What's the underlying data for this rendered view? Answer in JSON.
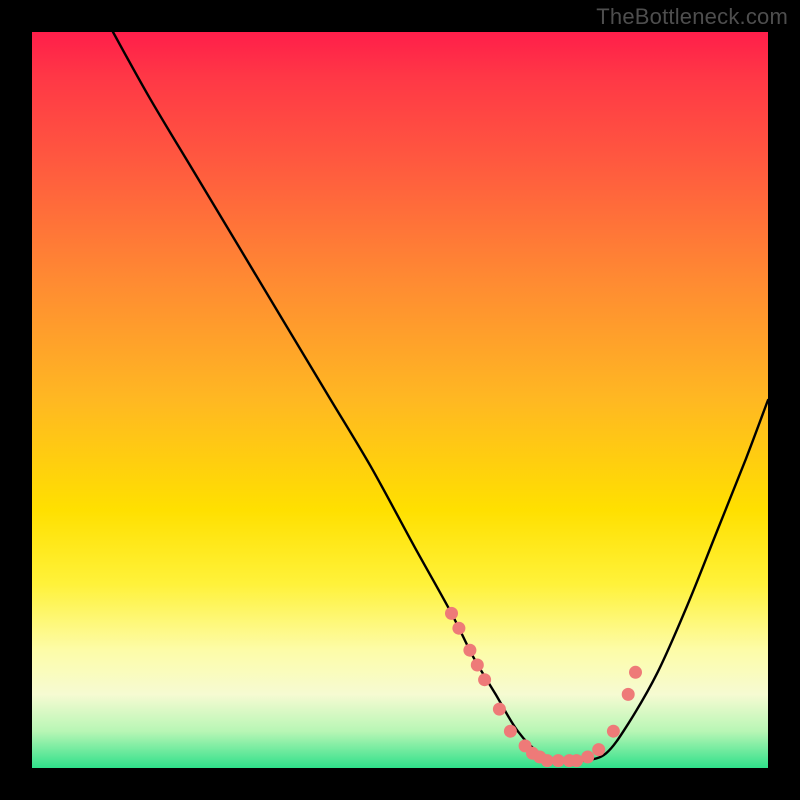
{
  "watermark": "TheBottleneck.com",
  "chart_data": {
    "type": "line",
    "title": "",
    "xlabel": "",
    "ylabel": "",
    "xlim": [
      0,
      100
    ],
    "ylim": [
      0,
      100
    ],
    "series": [
      {
        "name": "bottleneck-curve",
        "x": [
          11,
          16,
          22,
          28,
          34,
          40,
          46,
          52,
          57,
          60,
          63,
          66,
          69,
          72,
          75,
          78,
          81,
          85,
          89,
          93,
          97,
          100
        ],
        "values": [
          100,
          91,
          81,
          71,
          61,
          51,
          41,
          30,
          21,
          15,
          10,
          5,
          2,
          1,
          1,
          2,
          6,
          13,
          22,
          32,
          42,
          50
        ]
      }
    ],
    "markers": {
      "name": "highlight-points",
      "color": "#ee7a78",
      "x": [
        57,
        58,
        59.5,
        60.5,
        61.5,
        63.5,
        65,
        67,
        68,
        69,
        70,
        71.5,
        73,
        74,
        75.5,
        77,
        79,
        81,
        82
      ],
      "values": [
        21,
        19,
        16,
        14,
        12,
        8,
        5,
        3,
        2,
        1.5,
        1,
        1,
        1,
        1,
        1.5,
        2.5,
        5,
        10,
        13
      ]
    },
    "gradient_stops": [
      {
        "pos": 0,
        "color": "#ff1e4a"
      },
      {
        "pos": 6,
        "color": "#ff3746"
      },
      {
        "pos": 18,
        "color": "#ff5a3f"
      },
      {
        "pos": 34,
        "color": "#ff8b32"
      },
      {
        "pos": 50,
        "color": "#ffb822"
      },
      {
        "pos": 65,
        "color": "#ffe000"
      },
      {
        "pos": 75,
        "color": "#fff23a"
      },
      {
        "pos": 84,
        "color": "#fdfca8"
      },
      {
        "pos": 90,
        "color": "#f6fbd2"
      },
      {
        "pos": 95,
        "color": "#b8f6b5"
      },
      {
        "pos": 100,
        "color": "#2fe08a"
      }
    ]
  }
}
